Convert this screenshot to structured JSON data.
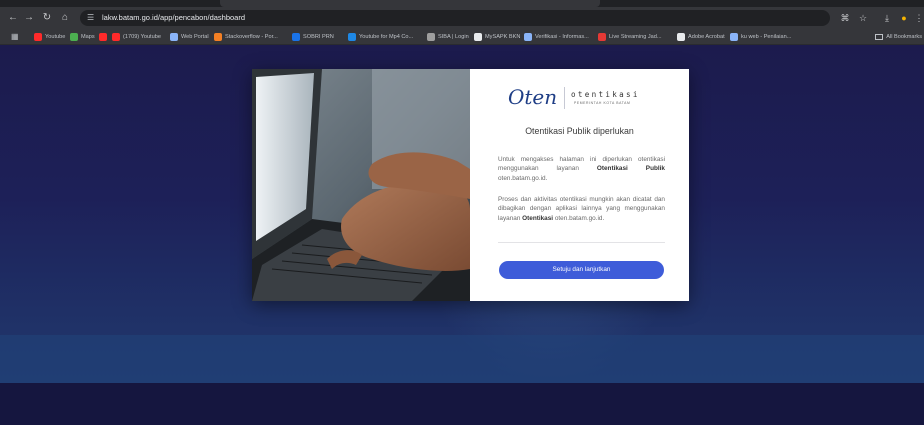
{
  "browser": {
    "url": "lakw.batam.go.id/app/pencabon/dashboard",
    "bookmarks": [
      {
        "label": "Youtube",
        "color": "#ff2a2a"
      },
      {
        "label": "Maps",
        "color": "#4caf50"
      },
      {
        "label": "",
        "color": "#ff2a2a"
      },
      {
        "label": "(1709) Youtube",
        "color": "#ff2a2a"
      },
      {
        "label": "Web Portal",
        "color": "#8ab4f8"
      },
      {
        "label": "Stackoverflow - Por...",
        "color": "#f48024"
      },
      {
        "label": "SOBRI PRN",
        "color": "#1a73e8"
      },
      {
        "label": "Youtube for Mp4 Co...",
        "color": "#1e88e5"
      },
      {
        "label": "SIBA | Login",
        "color": "#9e9e9e"
      },
      {
        "label": "MySAPK BKN",
        "color": "#e8eaed"
      },
      {
        "label": "Verifikasi - Informas...",
        "color": "#8ab4f8"
      },
      {
        "label": "Live Streaming Jad...",
        "color": "#e53935"
      },
      {
        "label": "Adobe Acrobat",
        "color": "#e8eaed"
      },
      {
        "label": "ku web - Penilaian...",
        "color": "#8ab4f8"
      }
    ],
    "all_bookmarks": "All Bookmarks"
  },
  "modal": {
    "logo_script": "Oten",
    "logo_word": "otentikasi",
    "logo_sub": "PEMERINTAH KOTA BATAM",
    "title": "Otentikasi Publik diperlukan",
    "para1_before": "Untuk mengakses halaman ini diperlukan otentikasi menggunakan layanan ",
    "para1_bold": "Otentikasi Publik",
    "para1_after": " oten.batam.go.id.",
    "para2_before": "Proses dan aktivitas otentikasi mungkin akan dicatat dan dibagikan dengan aplikasi lainnya yang menggunakan layanan ",
    "para2_bold": "Otentikasi",
    "para2_after": " oten.batam.go.id.",
    "button": "Setuju dan lanjutkan"
  }
}
